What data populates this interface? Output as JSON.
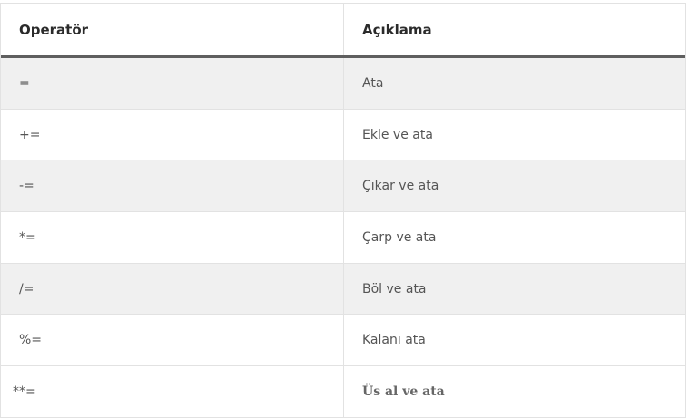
{
  "table": {
    "headers": [
      "Operatör",
      "Açıklama"
    ],
    "rows": [
      {
        "operator": "=",
        "description": "Ata"
      },
      {
        "operator": "+=",
        "description": "Ekle ve ata"
      },
      {
        "operator": "-=",
        "description": "Çıkar ve ata"
      },
      {
        "operator": "*=",
        "description": "Çarp ve ata"
      },
      {
        "operator": "/=",
        "description": "Böl ve ata"
      },
      {
        "operator": "%=",
        "description": "Kalanı ata"
      },
      {
        "operator": "**=",
        "description": "Üs al ve ata"
      }
    ]
  },
  "colors": {
    "header_rule": "#5f5f5f",
    "stripe": "#f0f0f0",
    "border": "#e2e2e2",
    "text": "#555555"
  }
}
